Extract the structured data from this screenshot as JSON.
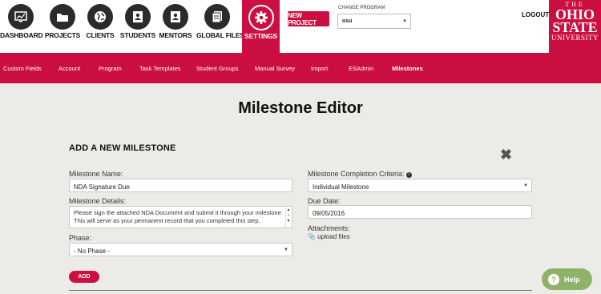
{
  "topnav": {
    "items": [
      {
        "label": "DASHBOARD",
        "icon": "dashboard-icon"
      },
      {
        "label": "PROJECTS",
        "icon": "folder-icon"
      },
      {
        "label": "CLIENTS",
        "icon": "globe-icon"
      },
      {
        "label": "STUDENTS",
        "icon": "contact-card-icon"
      },
      {
        "label": "MENTORS",
        "icon": "mentor-card-icon"
      },
      {
        "label": "GLOBAL FILES",
        "icon": "files-icon"
      },
      {
        "label": "SETTINGS",
        "icon": "gear-icon",
        "active": true
      }
    ],
    "new_project": "NEW PROJECT",
    "change_program_label": "CHANGE PROGRAM",
    "program_value": "osu",
    "logout": "LOGOUT",
    "logo": {
      "line1": "THE",
      "line2": "OHIO",
      "line3": "STATE",
      "line4": "UNIVERSITY"
    }
  },
  "subnav": {
    "items": [
      "Custom Fields",
      "Account",
      "Program",
      "Task Templates",
      "Student Groups",
      "Manual Survey",
      "Import",
      "ESAdmin",
      "Milestones"
    ],
    "active": "Milestones"
  },
  "page_title": "Milestone Editor",
  "form": {
    "section_title": "ADD A NEW MILESTONE",
    "name_label": "Milestone Name:",
    "name_value": "NDA Signature Due",
    "details_label": "Milestone Details:",
    "details_value": "Please sign the attached NDA Document and submit it through your milestone. This will serve as your permanent record that you completed this step.",
    "phase_label": "Phase:",
    "phase_value": "- No Phase -",
    "criteria_label": "Milestone Completion Criteria:",
    "criteria_value": "Individual Milestone",
    "due_label": "Due Date:",
    "due_value": "09/05/2016",
    "attachments_label": "Attachments:",
    "upload_label": "upload files",
    "add_button": "ADD"
  },
  "help_label": "Help",
  "colors": {
    "brand": "#cc0f41",
    "help": "#8fb26b"
  }
}
